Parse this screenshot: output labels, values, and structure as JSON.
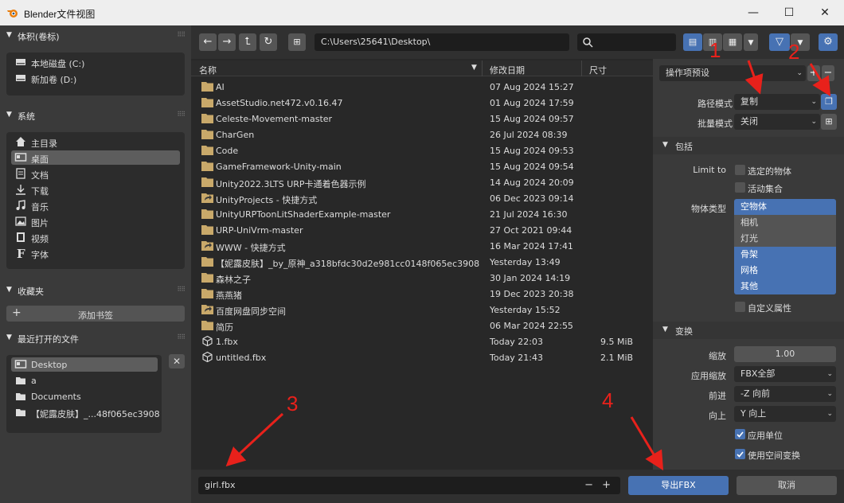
{
  "window": {
    "title": "Blender文件视图",
    "minimize": "—",
    "maximize": "☐",
    "close": "✕"
  },
  "sidebar": {
    "volumes": {
      "title": "体积(卷标)",
      "items": [
        {
          "label": "本地磁盘 (C:)",
          "icon": "drive-icon"
        },
        {
          "label": "新加卷 (D:)",
          "icon": "drive-icon"
        }
      ]
    },
    "system": {
      "title": "系统",
      "items": [
        {
          "label": "主目录",
          "icon": "home-icon"
        },
        {
          "label": "桌面",
          "icon": "desktop-icon",
          "selected": true
        },
        {
          "label": "文档",
          "icon": "document-icon"
        },
        {
          "label": "下载",
          "icon": "download-icon"
        },
        {
          "label": "音乐",
          "icon": "music-icon"
        },
        {
          "label": "图片",
          "icon": "image-icon"
        },
        {
          "label": "视频",
          "icon": "video-icon"
        },
        {
          "label": "字体",
          "icon": "font-icon"
        }
      ]
    },
    "bookmarks": {
      "title": "收藏夹",
      "add_label": "添加书签"
    },
    "recent": {
      "title": "最近打开的文件",
      "items": [
        {
          "label": "Desktop",
          "selected": true
        },
        {
          "label": "a"
        },
        {
          "label": "Documents"
        },
        {
          "label": "【妮露皮肤】_...48f065ec3908"
        }
      ]
    }
  },
  "toolbar": {
    "path": "C:\\Users\\25641\\Desktop\\"
  },
  "file_list": {
    "columns": {
      "name": "名称",
      "date": "修改日期",
      "size": "尺寸"
    },
    "rows": [
      {
        "name": "AI",
        "date": "07 Aug 2024 15:27",
        "size": "",
        "type": "folder"
      },
      {
        "name": "AssetStudio.net472.v0.16.47",
        "date": "01 Aug 2024 17:59",
        "size": "",
        "type": "folder"
      },
      {
        "name": "Celeste-Movement-master",
        "date": "15 Aug 2024 09:57",
        "size": "",
        "type": "folder"
      },
      {
        "name": "CharGen",
        "date": "26 Jul 2024 08:39",
        "size": "",
        "type": "folder"
      },
      {
        "name": "Code",
        "date": "15 Aug 2024 09:53",
        "size": "",
        "type": "folder"
      },
      {
        "name": "GameFramework-Unity-main",
        "date": "15 Aug 2024 09:54",
        "size": "",
        "type": "folder"
      },
      {
        "name": "Unity2022.3LTS URP卡通着色器示例",
        "date": "14 Aug 2024 20:09",
        "size": "",
        "type": "folder"
      },
      {
        "name": "UnityProjects - 快捷方式",
        "date": "06 Dec 2023 09:14",
        "size": "",
        "type": "link"
      },
      {
        "name": "UnityURPToonLitShaderExample-master",
        "date": "21 Jul 2024 16:30",
        "size": "",
        "type": "folder"
      },
      {
        "name": "URP-UniVrm-master",
        "date": "27 Oct 2021 09:44",
        "size": "",
        "type": "folder"
      },
      {
        "name": "WWW - 快捷方式",
        "date": "16 Mar 2024 17:41",
        "size": "",
        "type": "link"
      },
      {
        "name": "【妮露皮肤】_by_原神_a318bfdc30d2e981cc0148f065ec3908",
        "date": "Yesterday 13:49",
        "size": "",
        "type": "folder"
      },
      {
        "name": "森林之子",
        "date": "30 Jan 2024 14:19",
        "size": "",
        "type": "folder"
      },
      {
        "name": "燕燕猪",
        "date": "19 Dec 2023 20:38",
        "size": "",
        "type": "folder"
      },
      {
        "name": "百度网盘同步空间",
        "date": "Yesterday 15:52",
        "size": "",
        "type": "link"
      },
      {
        "name": "简历",
        "date": "06 Mar 2024 22:55",
        "size": "",
        "type": "folder"
      },
      {
        "name": "1.fbx",
        "date": "Today 22:03",
        "size": "9.5 MiB",
        "type": "file"
      },
      {
        "name": "untitled.fbx",
        "date": "Today 21:43",
        "size": "2.1 MiB",
        "type": "file"
      }
    ]
  },
  "footer": {
    "filename": "girl.fbx",
    "minus": "−",
    "plus": "+",
    "export_label": "导出FBX",
    "cancel_label": "取消"
  },
  "settings": {
    "preset": "操作项预设",
    "path_mode_label": "路径模式",
    "path_mode": "复制",
    "batch_mode_label": "批量模式",
    "batch_mode": "关闭",
    "include_title": "包括",
    "limit_to_label": "Limit to",
    "selected_objects": "选定的物体",
    "active_collection": "活动集合",
    "object_types_label": "物体类型",
    "object_types": [
      {
        "label": "空物体",
        "on": true
      },
      {
        "label": "相机",
        "on": false
      },
      {
        "label": "灯光",
        "on": false
      },
      {
        "label": "骨架",
        "on": true
      },
      {
        "label": "网格",
        "on": true
      },
      {
        "label": "其他",
        "on": true
      }
    ],
    "custom_props": "自定义属性",
    "transform_title": "变换",
    "scale_label": "缩放",
    "scale": "1.00",
    "apply_scale_label": "应用缩放",
    "apply_scale": "FBX全部",
    "forward_label": "前进",
    "forward": "-Z 向前",
    "up_label": "向上",
    "up": "Y 向上",
    "apply_unit": "应用单位",
    "use_space_transform": "使用空间变换"
  },
  "annotations": [
    "1",
    "2",
    "3",
    "4"
  ],
  "colors": {
    "accent": "#4772b3",
    "annotation": "#e8211b",
    "list_bg": "#282828",
    "panel_bg": "#3a3a3a"
  }
}
